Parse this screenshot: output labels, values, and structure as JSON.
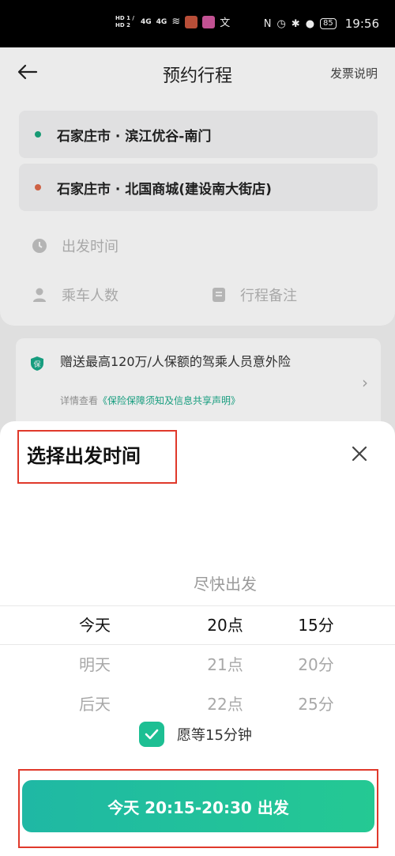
{
  "status_bar": {
    "network_left": "HD 1 / HD 2",
    "signal_1": "4G",
    "signal_2": "4G",
    "battery": "85",
    "time": "19:56"
  },
  "header": {
    "title": "预约行程",
    "invoice_link": "发票说明"
  },
  "route": {
    "from": "石家庄市 · 滨江优谷-南门",
    "to": "石家庄市 · 北国商城(建设南大街店)",
    "from_dot_color": "#1aa87e",
    "to_dot_color": "#e06a4a"
  },
  "fields": {
    "departure_time": "出发时间",
    "passengers": "乘车人数",
    "notes": "行程备注"
  },
  "insurance": {
    "title": "赠送最高120万/人保额的驾乘人员意外险",
    "details_prefix": "详情查看",
    "details_link": "《保险保障须知及信息共享声明》",
    "badge": "保"
  },
  "sheet": {
    "title": "选择出发时间",
    "asap": "尽快出发",
    "days": [
      "今天",
      "明天",
      "后天"
    ],
    "hours": [
      "20点",
      "21点",
      "22点"
    ],
    "minutes": [
      "15分",
      "20分",
      "25分"
    ],
    "wait_label": "愿等15分钟",
    "confirm_button": "今天 20:15-20:30 出发"
  },
  "colors": {
    "accent": "#1dbf93",
    "highlight_box": "#e0392b"
  }
}
